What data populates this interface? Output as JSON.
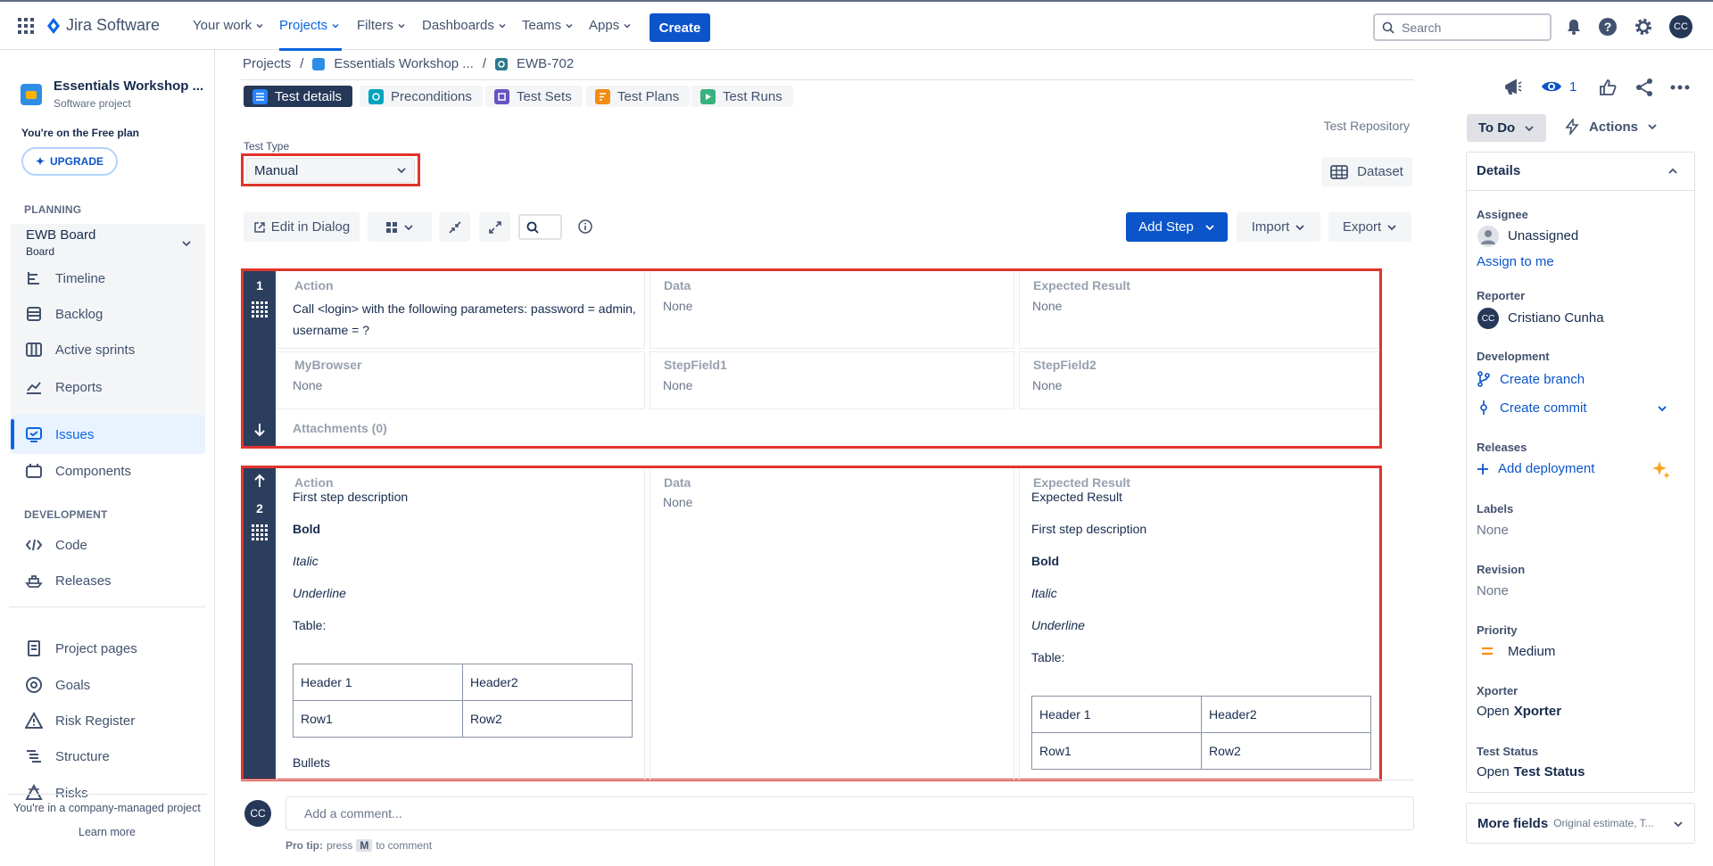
{
  "nav": {
    "product": "Jira Software",
    "your_work": "Your work",
    "projects": "Projects",
    "filters": "Filters",
    "dashboards": "Dashboards",
    "teams": "Teams",
    "apps": "Apps",
    "create": "Create",
    "search_placeholder": "Search",
    "avatar": "CC"
  },
  "sidebar": {
    "project_name": "Essentials Workshop ...",
    "project_type": "Software project",
    "plan_text": "You're on the Free plan",
    "upgrade": "UPGRADE",
    "planning_head": "PLANNING",
    "board_name": "EWB Board",
    "board_sub": "Board",
    "timeline": "Timeline",
    "backlog": "Backlog",
    "active_sprints": "Active sprints",
    "reports": "Reports",
    "issues": "Issues",
    "components": "Components",
    "development_head": "DEVELOPMENT",
    "code": "Code",
    "releases": "Releases",
    "project_pages": "Project pages",
    "goals": "Goals",
    "risk_register": "Risk Register",
    "structure": "Structure",
    "risks": "Risks",
    "footer_text": "You're in a company-managed project",
    "learn_more": "Learn more"
  },
  "breadcrumb": {
    "projects": "Projects",
    "project": "Essentials Workshop ...",
    "issue": "EWB-702"
  },
  "tabs": [
    "Test details",
    "Preconditions",
    "Test Sets",
    "Test Plans",
    "Test Runs"
  ],
  "test_repository": "Test Repository",
  "test_type": {
    "label": "Test Type",
    "value": "Manual"
  },
  "dataset": "Dataset",
  "toolbar": {
    "edit_in_dialog": "Edit in Dialog",
    "add_step": "Add Step",
    "import": "Import",
    "export": "Export"
  },
  "step1": {
    "number": "1",
    "action_label": "Action",
    "action_value": "Call <login> with the following parameters: password = admin, username = ?",
    "data_label": "Data",
    "data_value": "None",
    "expected_label": "Expected Result",
    "expected_value": "None",
    "mybrowser_label": "MyBrowser",
    "mybrowser_value": "None",
    "stepfield1_label": "StepField1",
    "stepfield1_value": "None",
    "stepfield2_label": "StepField2",
    "stepfield2_value": "None",
    "attachments": "Attachments (0)"
  },
  "step2": {
    "number": "2",
    "action_label": "Action",
    "data_label": "Data",
    "data_value": "None",
    "expected_label": "Expected Result",
    "action_lines": [
      "First step description",
      "Bold",
      "Italic",
      "Underline",
      "Table:"
    ],
    "action_table": [
      [
        "Header 1",
        "Header2"
      ],
      [
        "Row1",
        "Row2"
      ]
    ],
    "action_bullets": "Bullets",
    "expected_lines": [
      "Expected Result",
      "First step description",
      "Bold",
      "Italic",
      "Underline",
      "Table:"
    ],
    "expected_table": [
      [
        "Header 1",
        "Header2"
      ],
      [
        "Row1",
        "Row2"
      ]
    ]
  },
  "comment": {
    "avatar": "CC",
    "placeholder": "Add a comment...",
    "tip_prefix": "Pro tip:",
    "tip_press": "press",
    "tip_key": "M",
    "tip_suffix": "to comment"
  },
  "right": {
    "watchers": "1",
    "status": "To Do",
    "actions": "Actions",
    "details": "Details",
    "assignee_label": "Assignee",
    "assignee_value": "Unassigned",
    "assign_to_me": "Assign to me",
    "reporter_label": "Reporter",
    "reporter_value": "Cristiano Cunha",
    "reporter_avatar": "CC",
    "development_label": "Development",
    "create_branch": "Create branch",
    "create_commit": "Create commit",
    "releases_label": "Releases",
    "add_deployment": "Add deployment",
    "labels_label": "Labels",
    "labels_value": "None",
    "revision_label": "Revision",
    "revision_value": "None",
    "priority_label": "Priority",
    "priority_value": "Medium",
    "xporter_label": "Xporter",
    "xporter_open": "Open",
    "xporter_value": "Xporter",
    "test_status_label": "Test Status",
    "test_status_open": "Open",
    "test_status_value": "Test Status",
    "more_fields": "More fields",
    "more_fields_hint": "Original estimate, T..."
  },
  "colors": {
    "brand": "#0c54c9",
    "highlight": "#e0342c",
    "step_bar": "#2c3e5d"
  }
}
